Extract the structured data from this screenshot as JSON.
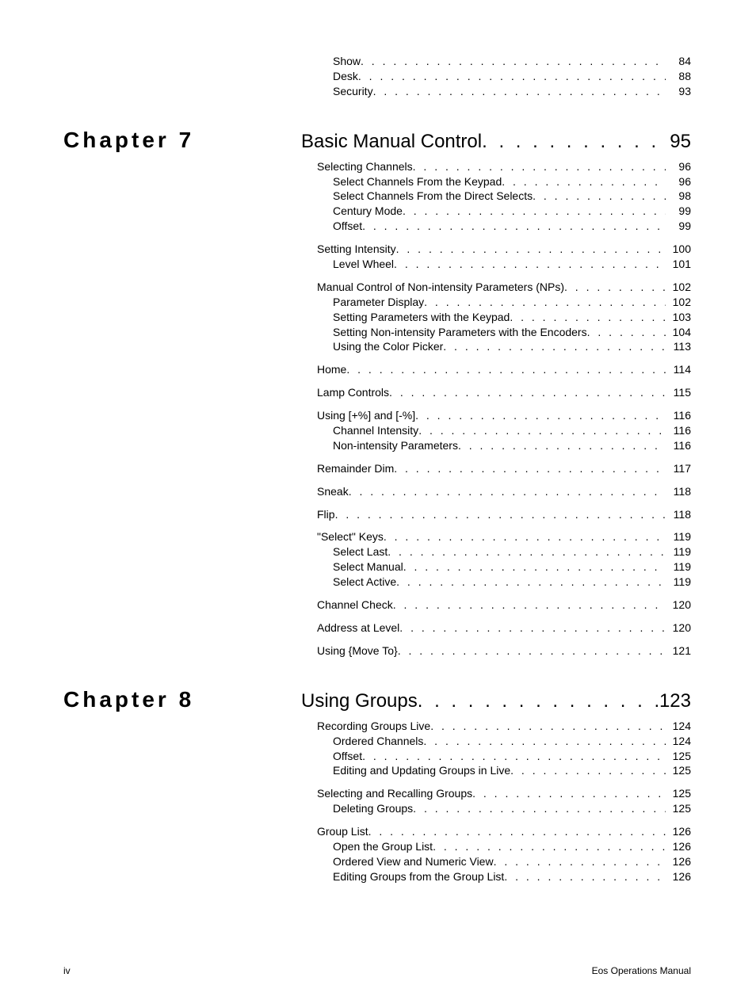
{
  "pre_entries": [
    {
      "label": "Show",
      "page": "84",
      "indent": 2
    },
    {
      "label": "Desk",
      "page": "88",
      "indent": 2
    },
    {
      "label": "Security",
      "page": "93",
      "indent": 2
    }
  ],
  "chapters": [
    {
      "chapter_label": "Chapter 7",
      "title": "Basic Manual Control",
      "page": "95",
      "groups": [
        [
          {
            "label": "Selecting Channels",
            "page": "96",
            "indent": 1
          },
          {
            "label": "Select Channels From the Keypad",
            "page": "96",
            "indent": 2
          },
          {
            "label": "Select Channels From the Direct Selects",
            "page": "98",
            "indent": 2
          },
          {
            "label": "Century Mode",
            "page": "99",
            "indent": 2
          },
          {
            "label": "Offset",
            "page": "99",
            "indent": 2
          }
        ],
        [
          {
            "label": "Setting Intensity",
            "page": "100",
            "indent": 1
          },
          {
            "label": "Level Wheel",
            "page": "101",
            "indent": 2
          }
        ],
        [
          {
            "label": "Manual Control of Non-intensity Parameters (NPs)",
            "page": "102",
            "indent": 1
          },
          {
            "label": "Parameter Display",
            "page": "102",
            "indent": 2
          },
          {
            "label": "Setting Parameters with the Keypad",
            "page": "103",
            "indent": 2
          },
          {
            "label": "Setting Non-intensity Parameters with the Encoders",
            "page": "104",
            "indent": 2
          },
          {
            "label": "Using the Color Picker",
            "page": "113",
            "indent": 2
          }
        ],
        [
          {
            "label": "Home",
            "page": "114",
            "indent": 1
          }
        ],
        [
          {
            "label": "Lamp Controls",
            "page": "115",
            "indent": 1
          }
        ],
        [
          {
            "label": "Using [+%] and [-%]",
            "page": "116",
            "indent": 1
          },
          {
            "label": "Channel Intensity",
            "page": "116",
            "indent": 2
          },
          {
            "label": "Non-intensity Parameters",
            "page": "116",
            "indent": 2
          }
        ],
        [
          {
            "label": "Remainder Dim",
            "page": "117",
            "indent": 1
          }
        ],
        [
          {
            "label": "Sneak",
            "page": "118",
            "indent": 1
          }
        ],
        [
          {
            "label": "Flip",
            "page": "118",
            "indent": 1
          }
        ],
        [
          {
            "label": "\"Select\" Keys",
            "page": "119",
            "indent": 1
          },
          {
            "label": "Select Last",
            "page": "119",
            "indent": 2
          },
          {
            "label": "Select Manual",
            "page": "119",
            "indent": 2
          },
          {
            "label": "Select Active",
            "page": "119",
            "indent": 2
          }
        ],
        [
          {
            "label": "Channel Check",
            "page": "120",
            "indent": 1
          }
        ],
        [
          {
            "label": "Address at Level",
            "page": "120",
            "indent": 1
          }
        ],
        [
          {
            "label": "Using {Move To}",
            "page": "121",
            "indent": 1
          }
        ]
      ]
    },
    {
      "chapter_label": "Chapter 8",
      "title": "Using Groups",
      "page": "123",
      "groups": [
        [
          {
            "label": "Recording Groups Live",
            "page": "124",
            "indent": 1
          },
          {
            "label": "Ordered Channels",
            "page": "124",
            "indent": 2
          },
          {
            "label": "Offset",
            "page": "125",
            "indent": 2
          },
          {
            "label": "Editing and Updating Groups in Live",
            "page": "125",
            "indent": 2
          }
        ],
        [
          {
            "label": "Selecting and Recalling Groups",
            "page": "125",
            "indent": 1
          },
          {
            "label": "Deleting Groups",
            "page": "125",
            "indent": 2
          }
        ],
        [
          {
            "label": "Group List",
            "page": "126",
            "indent": 1
          },
          {
            "label": "Open the Group List",
            "page": "126",
            "indent": 2
          },
          {
            "label": "Ordered View and Numeric View",
            "page": "126",
            "indent": 2
          },
          {
            "label": "Editing Groups from the Group List",
            "page": "126",
            "indent": 2
          }
        ]
      ]
    }
  ],
  "footer": {
    "left": "iv",
    "right": "Eos Operations Manual"
  }
}
